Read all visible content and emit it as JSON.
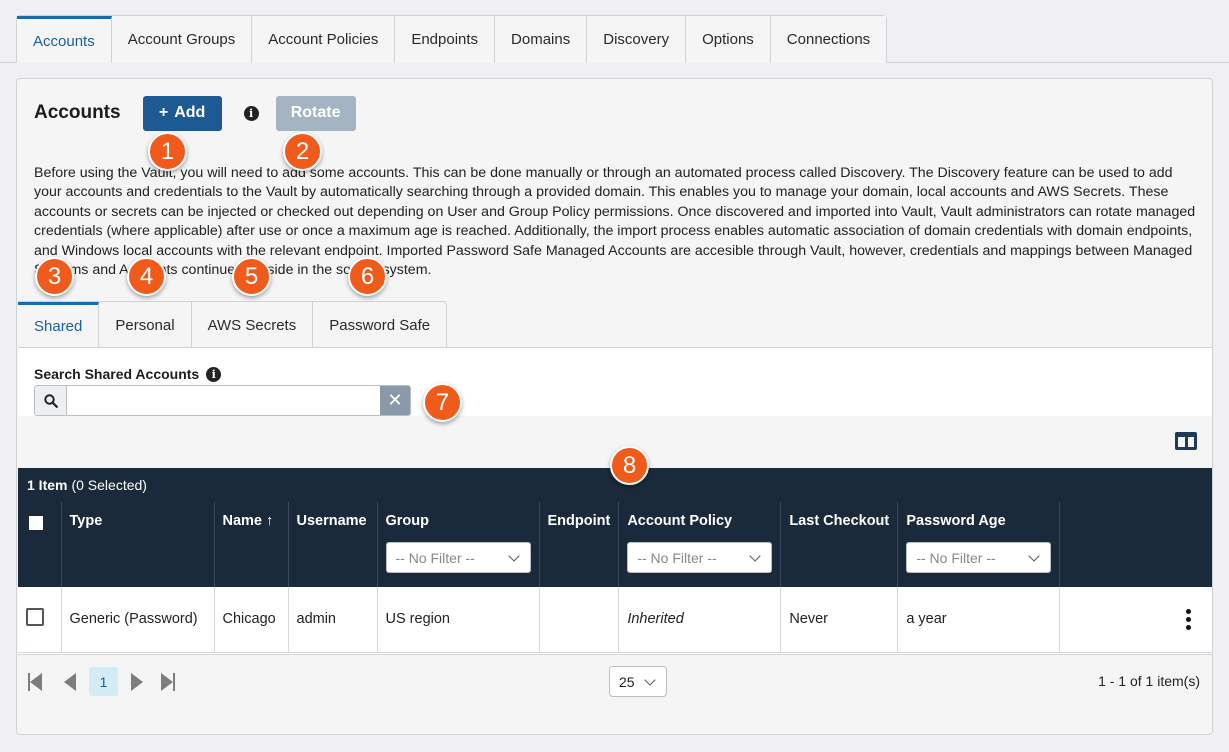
{
  "top_tabs": [
    "Accounts",
    "Account Groups",
    "Account Policies",
    "Endpoints",
    "Domains",
    "Discovery",
    "Options",
    "Connections"
  ],
  "header": {
    "title": "Accounts",
    "add_label": "Add",
    "rotate_label": "Rotate"
  },
  "description": "Before using the Vault, you will need to add some accounts. This can be done manually or through an automated process called Discovery. The Discovery feature can be used to add your accounts and credentials to the Vault by automatically searching through a provided domain. This enables you to manage your domain, local accounts and AWS Secrets. These accounts or secrets can be injected or checked out depending on User and Group Policy permissions. Once discovered and imported into Vault, Vault administrators can rotate managed credentials (where applicable) after use or once a maximum age is reached. Additionally, the import process enables automatic association of domain credentials with domain endpoints, and Windows local accounts with the relevant endpoint. Imported Password Safe Managed Accounts are accesible through Vault, however, credentials and mappings between Managed Systems and Accounts continue to reside in the source system.",
  "sub_tabs": [
    "Shared",
    "Personal",
    "AWS Secrets",
    "Password Safe"
  ],
  "search": {
    "label": "Search Shared Accounts",
    "value": ""
  },
  "table": {
    "count_bold": "1 Item",
    "count_rest": "(0 Selected)",
    "columns": [
      "Type",
      "Name ↑",
      "Username",
      "Group",
      "Endpoint",
      "Account Policy",
      "Last Checkout",
      "Password Age"
    ],
    "filter_placeholder": "-- No Filter --",
    "rows": [
      {
        "type": "Generic (Password)",
        "name": "Chicago",
        "username": "admin",
        "group": "US region",
        "endpoint": "",
        "policy": "Inherited",
        "last_checkout": "Never",
        "password_age": "a year"
      }
    ]
  },
  "pager": {
    "page": "1",
    "page_size": "25",
    "info": "1 - 1 of 1 item(s)"
  },
  "callouts": [
    "1",
    "2",
    "3",
    "4",
    "5",
    "6",
    "7",
    "8"
  ],
  "colors": {
    "accent": "#1a6ab0",
    "primary_button": "#1d5a93",
    "disabled_button": "#a5b4c3",
    "grid_header": "#1b2a3a",
    "callout": "#f05a1a"
  }
}
